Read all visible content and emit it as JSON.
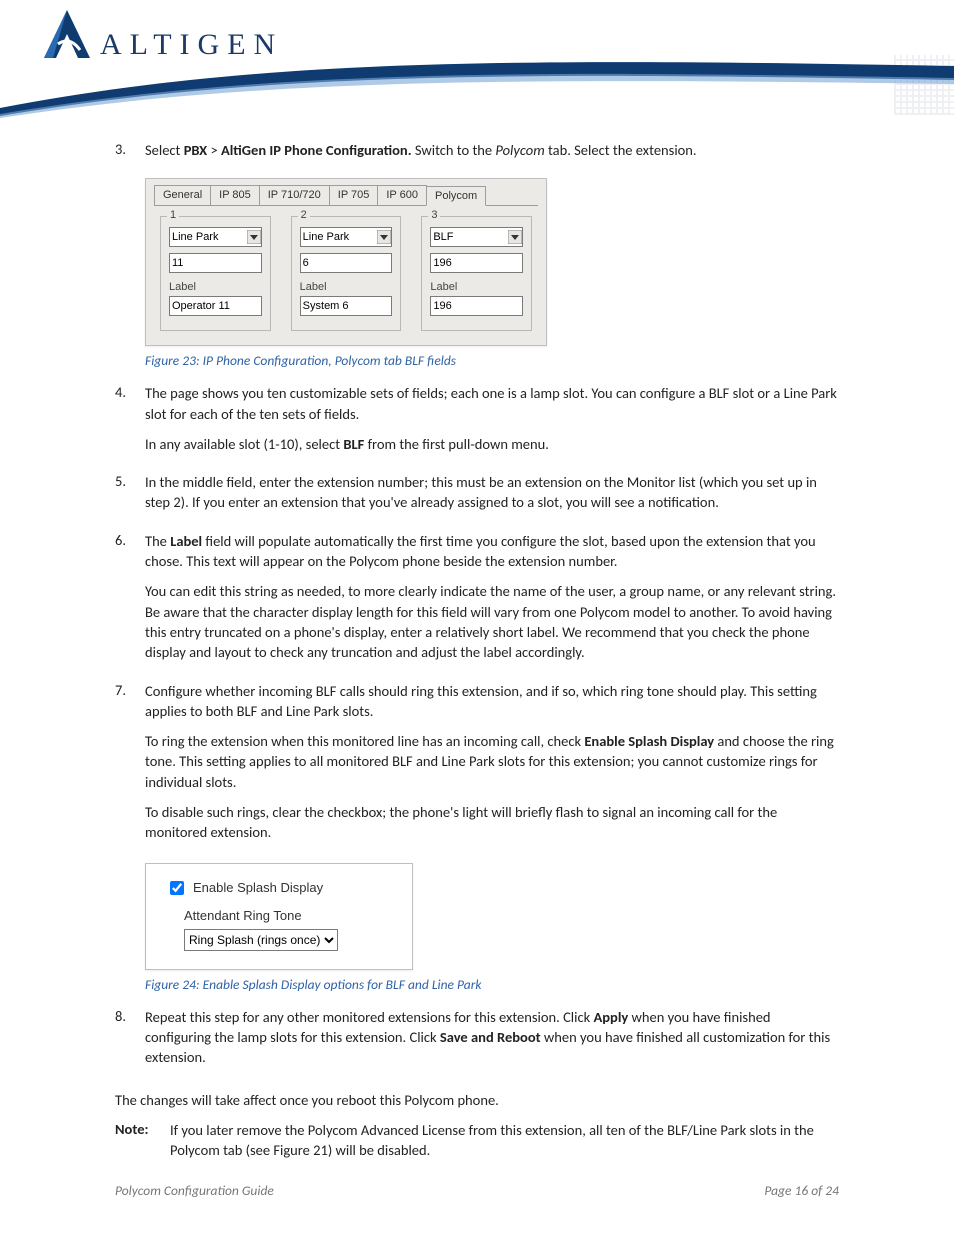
{
  "header": {
    "brand": "ALTIGEN"
  },
  "steps": {
    "s3": {
      "num": "3.",
      "t1a": "Select ",
      "t1b": "PBX",
      "t1c": " > ",
      "t1d": "AltiGen IP Phone Configuration.",
      "t1e": " Switch to the ",
      "t1f": "Polycom",
      "t1g": " tab. Select the extension."
    },
    "s4": {
      "num": "4.",
      "p1": "The page shows you ten customizable sets of fields; each one is a lamp slot. You can configure a BLF slot or a Line Park slot for each of the ten sets of fields.",
      "p2a": "In any available slot (1-10), select ",
      "p2b": "BLF",
      "p2c": " from the first pull-down menu."
    },
    "s5": {
      "num": "5.",
      "p1": "In the middle field, enter the extension number; this must be an extension on the Monitor list (which you set up in step 2).  If you enter an extension that you've already assigned to a slot, you will see a notification."
    },
    "s6": {
      "num": "6.",
      "p1a": "The ",
      "p1b": "Label",
      "p1c": " field will populate automatically the first time you configure the slot, based upon the extension that you chose. This text will appear on the Polycom phone beside the extension number.",
      "p2": "You can edit this string as needed, to more clearly indicate the name of the user, a group name, or any relevant string. Be aware that the character display length for this field will vary from one Polycom model to another. To avoid having this entry truncated on a phone's display, enter a relatively short label.  We recommend that you check the phone display and layout to check any truncation and adjust the label accordingly."
    },
    "s7": {
      "num": "7.",
      "p1": "Configure whether incoming BLF calls should ring this extension, and if so, which ring tone should play. This setting applies to both BLF and Line Park slots.",
      "p2a": "To ring the extension when this monitored line has an incoming call, check ",
      "p2b": "Enable Splash Display",
      "p2c": " and choose the ring tone.  This setting applies to all monitored BLF and Line Park slots for this extension; you cannot customize rings for individual slots.",
      "p3": "To disable such rings, clear the checkbox; the phone's light will briefly flash to signal an incoming call for the monitored extension."
    },
    "s8": {
      "num": "8.",
      "p1a": "Repeat this step for any other monitored extensions for this extension. Click ",
      "p1b": "Apply",
      "p1c": " when you have finished configuring the lamp slots for this extension. Click ",
      "p1d": "Save and Reboot",
      "p1e": " when you have finished all customization for this extension."
    }
  },
  "fig23": {
    "caption": "Figure 23: IP Phone Configuration, Polycom tab BLF fields",
    "tabs": [
      "General",
      "IP 805",
      "IP 710/720",
      "IP 705",
      "IP 600",
      "Polycom"
    ],
    "active_tab": "Polycom",
    "slots": [
      {
        "legend": "1",
        "type": "Line Park",
        "value": "11",
        "label_text": "Label",
        "label_value": "Operator 11"
      },
      {
        "legend": "2",
        "type": "Line Park",
        "value": "6",
        "label_text": "Label",
        "label_value": "System 6"
      },
      {
        "legend": "3",
        "type": "BLF",
        "value": "196",
        "label_text": "Label",
        "label_value": "196"
      }
    ]
  },
  "fig24": {
    "caption": "Figure 24: Enable Splash Display options for BLF and Line Park",
    "checkbox_label": "Enable Splash Display",
    "sublabel": "Attendant Ring Tone",
    "select_value": "Ring Splash (rings once)"
  },
  "closing": "The changes will take affect once you reboot this Polycom phone.",
  "note": {
    "label": "Note:",
    "text": "If you later remove the Polycom Advanced License from this extension, all ten of the BLF/Line Park slots in the Polycom tab (see Figure 21) will be disabled."
  },
  "footer": {
    "left": "Polycom Configuration Guide",
    "right": "Page 16 of 24"
  }
}
